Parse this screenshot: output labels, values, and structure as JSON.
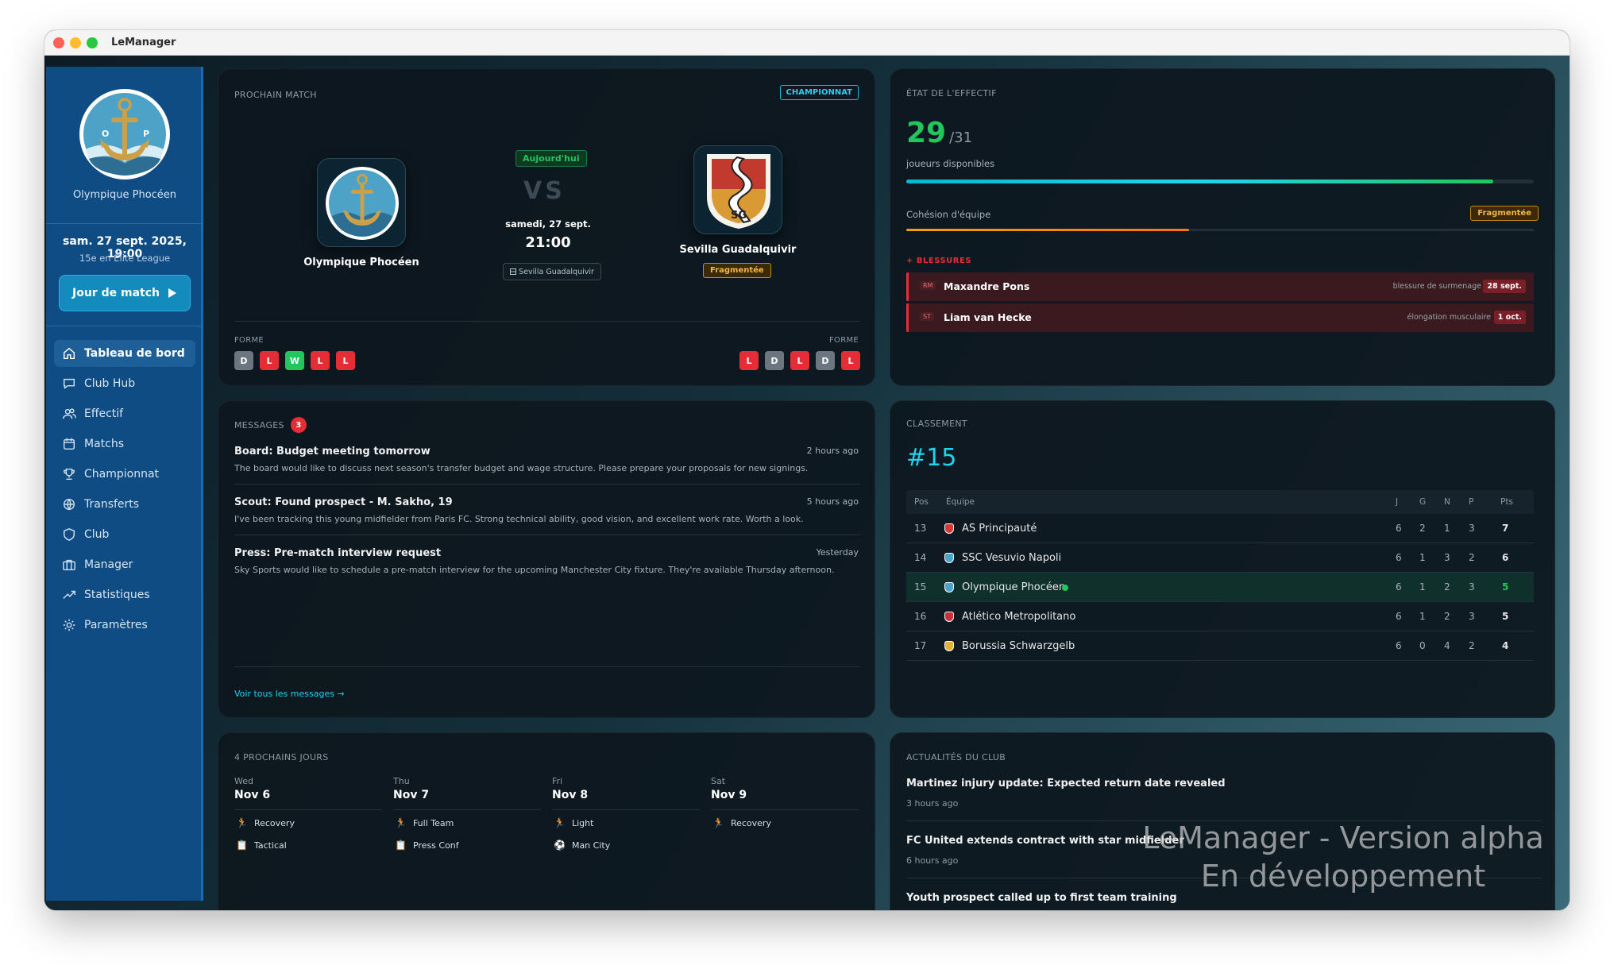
{
  "window": {
    "title": "LeManager"
  },
  "sidebar": {
    "club_name": "Olympique Phocéen",
    "date": "sam. 27 sept. 2025, 19:00",
    "rank": "15e en Elite League",
    "matchday_button": "Jour de match",
    "items": [
      {
        "label": "Tableau de bord",
        "icon": "home-icon"
      },
      {
        "label": "Club Hub",
        "icon": "chat-icon"
      },
      {
        "label": "Effectif",
        "icon": "users-icon"
      },
      {
        "label": "Matchs",
        "icon": "calendar-icon"
      },
      {
        "label": "Championnat",
        "icon": "trophy-icon"
      },
      {
        "label": "Transferts",
        "icon": "globe-icon"
      },
      {
        "label": "Club",
        "icon": "shield-icon"
      },
      {
        "label": "Manager",
        "icon": "briefcase-icon"
      },
      {
        "label": "Statistiques",
        "icon": "trend-icon"
      },
      {
        "label": "Paramètres",
        "icon": "gear-icon"
      }
    ]
  },
  "next_match": {
    "label": "PROCHAIN MATCH",
    "competition": "CHAMPIONNAT",
    "today": "Aujourd'hui",
    "vs": "VS",
    "date": "samedi, 27 sept.",
    "time": "21:00",
    "venue": "Sevilla Guadalquivir",
    "home_team": "Olympique Phocéen",
    "away_team": "Sevilla Guadalquivir",
    "away_badge_text": "SG",
    "away_cohesion": "Fragmentée",
    "form_label": "FORME",
    "home_form": [
      "D",
      "L",
      "W",
      "L",
      "L"
    ],
    "away_form": [
      "L",
      "D",
      "L",
      "D",
      "L"
    ]
  },
  "squad": {
    "label": "ÉTAT DE L'EFFECTIF",
    "available": "29",
    "total": "/31",
    "available_label": "joueurs disponibles",
    "availability_ratio": 0.935,
    "cohesion_label": "Cohésion d'équipe",
    "cohesion_value": "Fragmentée",
    "cohesion_ratio": 0.45,
    "injuries_label": "BLESSURES",
    "injuries": [
      {
        "pos": "RM",
        "name": "Maxandre Pons",
        "type": "blessure de surmenage",
        "return": "28 sept."
      },
      {
        "pos": "ST",
        "name": "Liam van Hecke",
        "type": "élongation musculaire",
        "return": "1 oct."
      }
    ]
  },
  "messages": {
    "label": "MESSAGES",
    "count": "3",
    "items": [
      {
        "title": "Board: Budget meeting tomorrow",
        "time": "2 hours ago",
        "body": "The board would like to discuss next season's transfer budget and wage structure. Please prepare your proposals for new signings."
      },
      {
        "title": "Scout: Found prospect - M. Sakho, 19",
        "time": "5 hours ago",
        "body": "I've been tracking this young midfielder from Paris FC. Strong technical ability, good vision, and excellent work rate. Worth a look."
      },
      {
        "title": "Press: Pre-match interview request",
        "time": "Yesterday",
        "body": "Sky Sports would like to schedule a pre-match interview for the upcoming Manchester City fixture. They're available Thursday afternoon."
      }
    ],
    "view_all": "Voir tous les messages →"
  },
  "standings": {
    "label": "CLASSEMENT",
    "position": "#15",
    "headers": [
      "Pos",
      "Équipe",
      "J",
      "G",
      "N",
      "P",
      "Pts"
    ],
    "rows": [
      {
        "pos": "13",
        "team": "AS Principauté",
        "j": "6",
        "g": "2",
        "n": "1",
        "p": "3",
        "pts": "7"
      },
      {
        "pos": "14",
        "team": "SSC Vesuvio Napoli",
        "j": "6",
        "g": "1",
        "n": "3",
        "p": "2",
        "pts": "6"
      },
      {
        "pos": "15",
        "team": "Olympique Phocéen",
        "j": "6",
        "g": "1",
        "n": "2",
        "p": "3",
        "pts": "5"
      },
      {
        "pos": "16",
        "team": "Atlético Metropolitano",
        "j": "6",
        "g": "1",
        "n": "2",
        "p": "3",
        "pts": "5"
      },
      {
        "pos": "17",
        "team": "Borussia Schwarzgelb",
        "j": "6",
        "g": "0",
        "n": "4",
        "p": "2",
        "pts": "4"
      }
    ]
  },
  "schedule": {
    "label": "4 PROCHAINS JOURS",
    "days": [
      {
        "weekday": "Wed",
        "date": "Nov 6",
        "activities": [
          "Recovery",
          "Tactical"
        ]
      },
      {
        "weekday": "Thu",
        "date": "Nov 7",
        "activities": [
          "Full Team",
          "Press Conf"
        ]
      },
      {
        "weekday": "Fri",
        "date": "Nov 8",
        "activities": [
          "Light",
          "Man City"
        ]
      },
      {
        "weekday": "Sat",
        "date": "Nov 9",
        "activities": [
          "Recovery"
        ]
      }
    ]
  },
  "news": {
    "label": "ACTUALITÉS DU CLUB",
    "items": [
      {
        "title": "Martinez injury update: Expected return date revealed",
        "time": "3 hours ago"
      },
      {
        "title": "FC United extends contract with star midfielder",
        "time": "6 hours ago"
      },
      {
        "title": "Youth prospect called up to first team training",
        "time": ""
      }
    ]
  },
  "watermark": {
    "line1": "LeManager - Version alpha",
    "line2": "En développement"
  },
  "colors": {
    "accent": "#22d3ee",
    "success": "#22c55e",
    "danger": "#e52d36",
    "warning": "#f59e0b",
    "sidebar": "#0f4c84"
  }
}
